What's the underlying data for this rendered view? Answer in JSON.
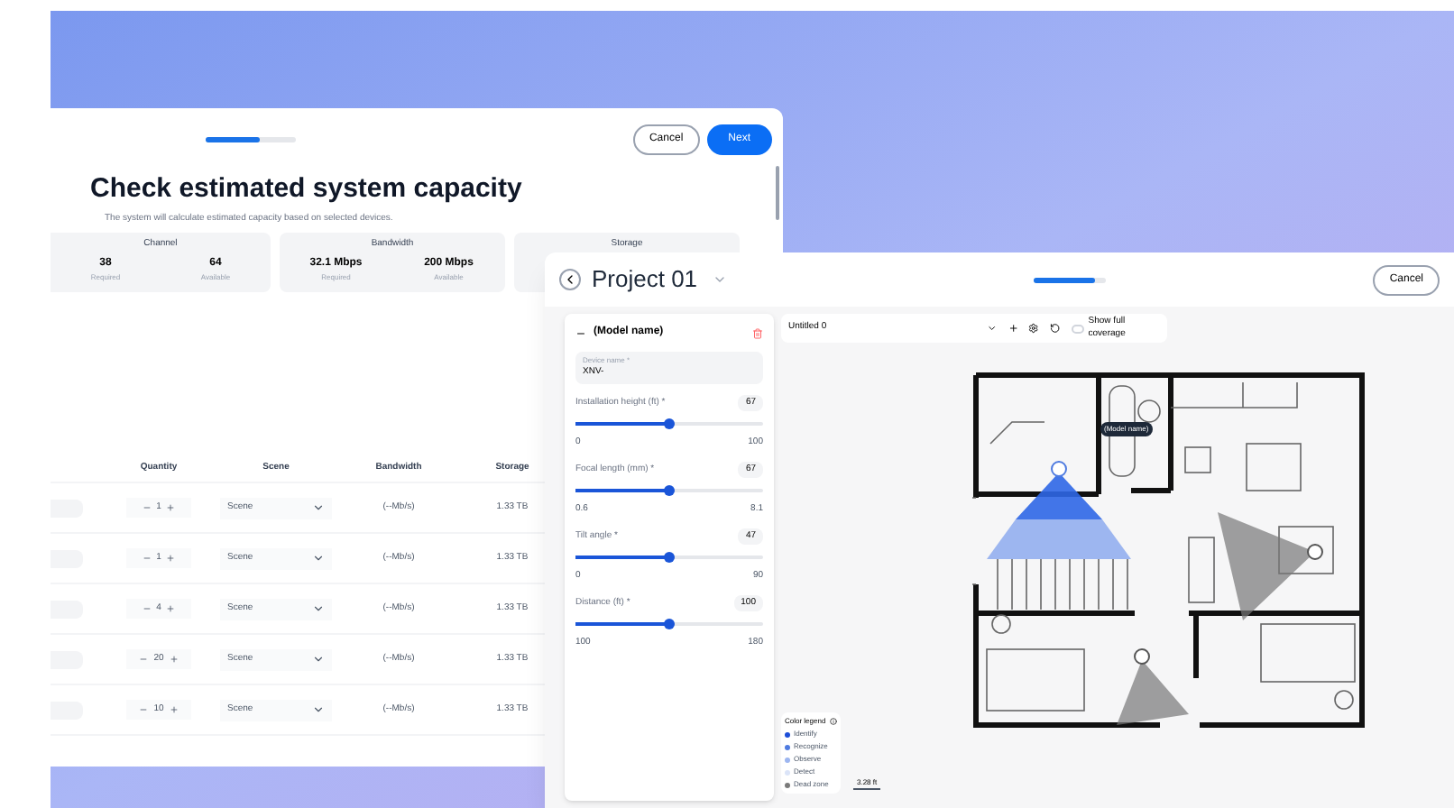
{
  "capacity_window": {
    "progress": {
      "level": 0.6
    },
    "buttons": {
      "cancel": "Cancel",
      "next": "Next"
    },
    "title": "Check estimated system capacity",
    "subtitle": "The system will calculate estimated capacity based on selected devices.",
    "summary": [
      {
        "title": "Channel",
        "items": [
          {
            "value": "38",
            "label": "Required"
          },
          {
            "value": "64",
            "label": "Available"
          }
        ]
      },
      {
        "title": "Bandwidth",
        "items": [
          {
            "value": "32.1 Mbps",
            "label": "Required"
          },
          {
            "value": "200 Mbps",
            "label": "Available"
          }
        ]
      },
      {
        "title": "Storage"
      }
    ],
    "columns": [
      "Quantity",
      "Scene",
      "Bandwidth",
      "Storage"
    ],
    "rows": [
      {
        "quantity": "1",
        "scene": "Scene",
        "bandwidth": "(--Mb/s)",
        "storage": "1.33 TB"
      },
      {
        "quantity": "1",
        "scene": "Scene",
        "bandwidth": "(--Mb/s)",
        "storage": "1.33 TB"
      },
      {
        "quantity": "4",
        "scene": "Scene",
        "bandwidth": "(--Mb/s)",
        "storage": "1.33 TB"
      },
      {
        "quantity": "20",
        "scene": "Scene",
        "bandwidth": "(--Mb/s)",
        "storage": "1.33 TB"
      },
      {
        "quantity": "10",
        "scene": "Scene",
        "bandwidth": "(--Mb/s)",
        "storage": "1.33 TB"
      }
    ]
  },
  "project_window": {
    "title": "Project 01",
    "progress": {
      "level": 0.85
    },
    "cancel": "Cancel",
    "device_panel": {
      "title": "(Model name)",
      "device_name_label": "Device name *",
      "device_name_value": "XNV-",
      "sliders": [
        {
          "label": "Installation height (ft) *",
          "value": "67",
          "min": "0",
          "max": "100",
          "level": 0.5
        },
        {
          "label": "Focal length (mm) *",
          "value": "67",
          "min": "0.6",
          "max": "8.1",
          "level": 0.5
        },
        {
          "label": "Tilt angle *",
          "value": "47",
          "min": "0",
          "max": "90",
          "level": 0.5
        },
        {
          "label": "Distance (ft) *",
          "value": "100",
          "min": "100",
          "max": "180",
          "level": 0.5
        }
      ]
    },
    "toolbar": {
      "floor": "Untitled 0",
      "show_full_coverage": {
        "label": "Show full coverage",
        "checked": false
      }
    },
    "map_tooltip": "(Model name)",
    "legend": {
      "title": "Color legend",
      "items": [
        {
          "label": "Identify",
          "color": "#1d4ed8"
        },
        {
          "label": "Recognize",
          "color": "#4f7be0"
        },
        {
          "label": "Observe",
          "color": "#9db6f0"
        },
        {
          "label": "Detect",
          "color": "#dbe4f8"
        },
        {
          "label": "Dead zone",
          "color": "#7a7a7a"
        }
      ]
    },
    "scale": "3.28 ft"
  }
}
